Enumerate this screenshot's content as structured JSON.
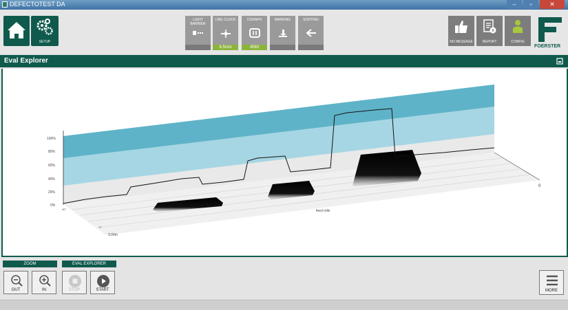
{
  "window": {
    "title": "DEFECTOTEST DA",
    "minimize": "–",
    "maximize": "▫",
    "close": "✕"
  },
  "toolbar": {
    "setup_label": "SETUP",
    "status_buttons": [
      {
        "label": "LIGHT BARRIER",
        "value": ""
      },
      {
        "label": "LINE CLOCK",
        "value": "6.5m/s"
      },
      {
        "label": "CGRAPH",
        "value": "4583"
      },
      {
        "label": "MARKING",
        "value": ""
      },
      {
        "label": "SORTING",
        "value": ""
      }
    ],
    "no_message_label": "NO MESSAGE",
    "report_label": "REPORT",
    "config_label": "CONFIG",
    "logo_text": "FOERSTER"
  },
  "header": {
    "title": "Eval Explorer"
  },
  "plot": {
    "y_ticks": [
      "100%",
      "80%",
      "60%",
      "40%",
      "20%",
      "0%"
    ],
    "axis_label_x": "feed rolls",
    "axis_zero": "0",
    "depth_label": "3.00m",
    "left_mark_1": "40°",
    "left_mark_2": "0°"
  },
  "bottom": {
    "zoom_label": "ZOOM",
    "zoom_out": "OUT",
    "zoom_in": "IN",
    "eval_label": "EVAL EXPLORER",
    "stop_label": "STOP",
    "start_label": "START",
    "more_label": "MORE"
  },
  "colors": {
    "primary": "#0f5a4c",
    "band_dark": "#5fb3c8",
    "band_light": "#a6d6e3",
    "accent_green": "#8cb43c"
  }
}
